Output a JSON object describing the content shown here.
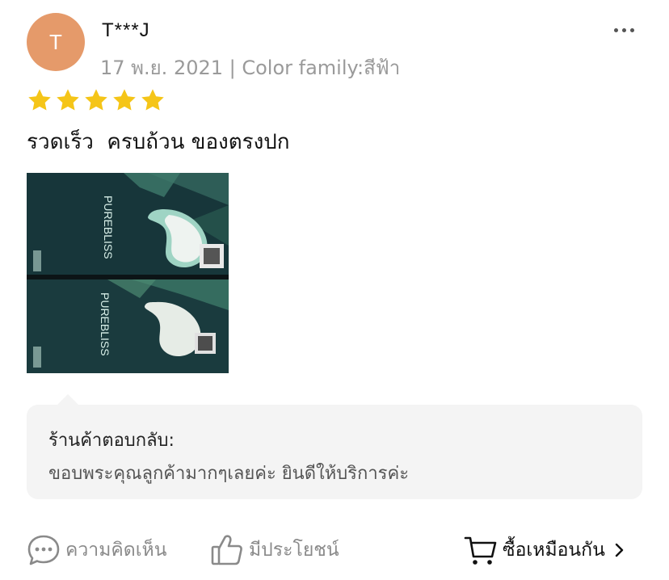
{
  "reviewer": {
    "avatar_initial": "T",
    "name": "T***J",
    "meta": "17 พ.ย. 2021 | Color family:สีฟ้า",
    "rating": 5
  },
  "review": {
    "text": "รวดเร็ว  ครบถ้วน ของตรงปก",
    "photo_texts": [
      "PUREBLISS",
      "PUREBLISS"
    ]
  },
  "seller_reply": {
    "title": "ร้านค้าตอบกลับ:",
    "body": "ขอบพระคุณลูกค้ามากๆเลยค่ะ ยินดีให้บริการค่ะ"
  },
  "actions": {
    "comment_label": "ความคิดเห็น",
    "helpful_label": "มีประโยชน์",
    "buy_same_label": "ซื้อเหมือนกัน"
  },
  "colors": {
    "avatar": "#e59a6a",
    "star": "#f5c518",
    "reply_bg": "#f4f4f4"
  },
  "icons": {
    "more": "more-dots-icon",
    "star": "star-icon",
    "comment": "comment-icon",
    "helpful": "thumbs-up-icon",
    "cart": "cart-icon",
    "chevron": "chevron-right-icon"
  }
}
